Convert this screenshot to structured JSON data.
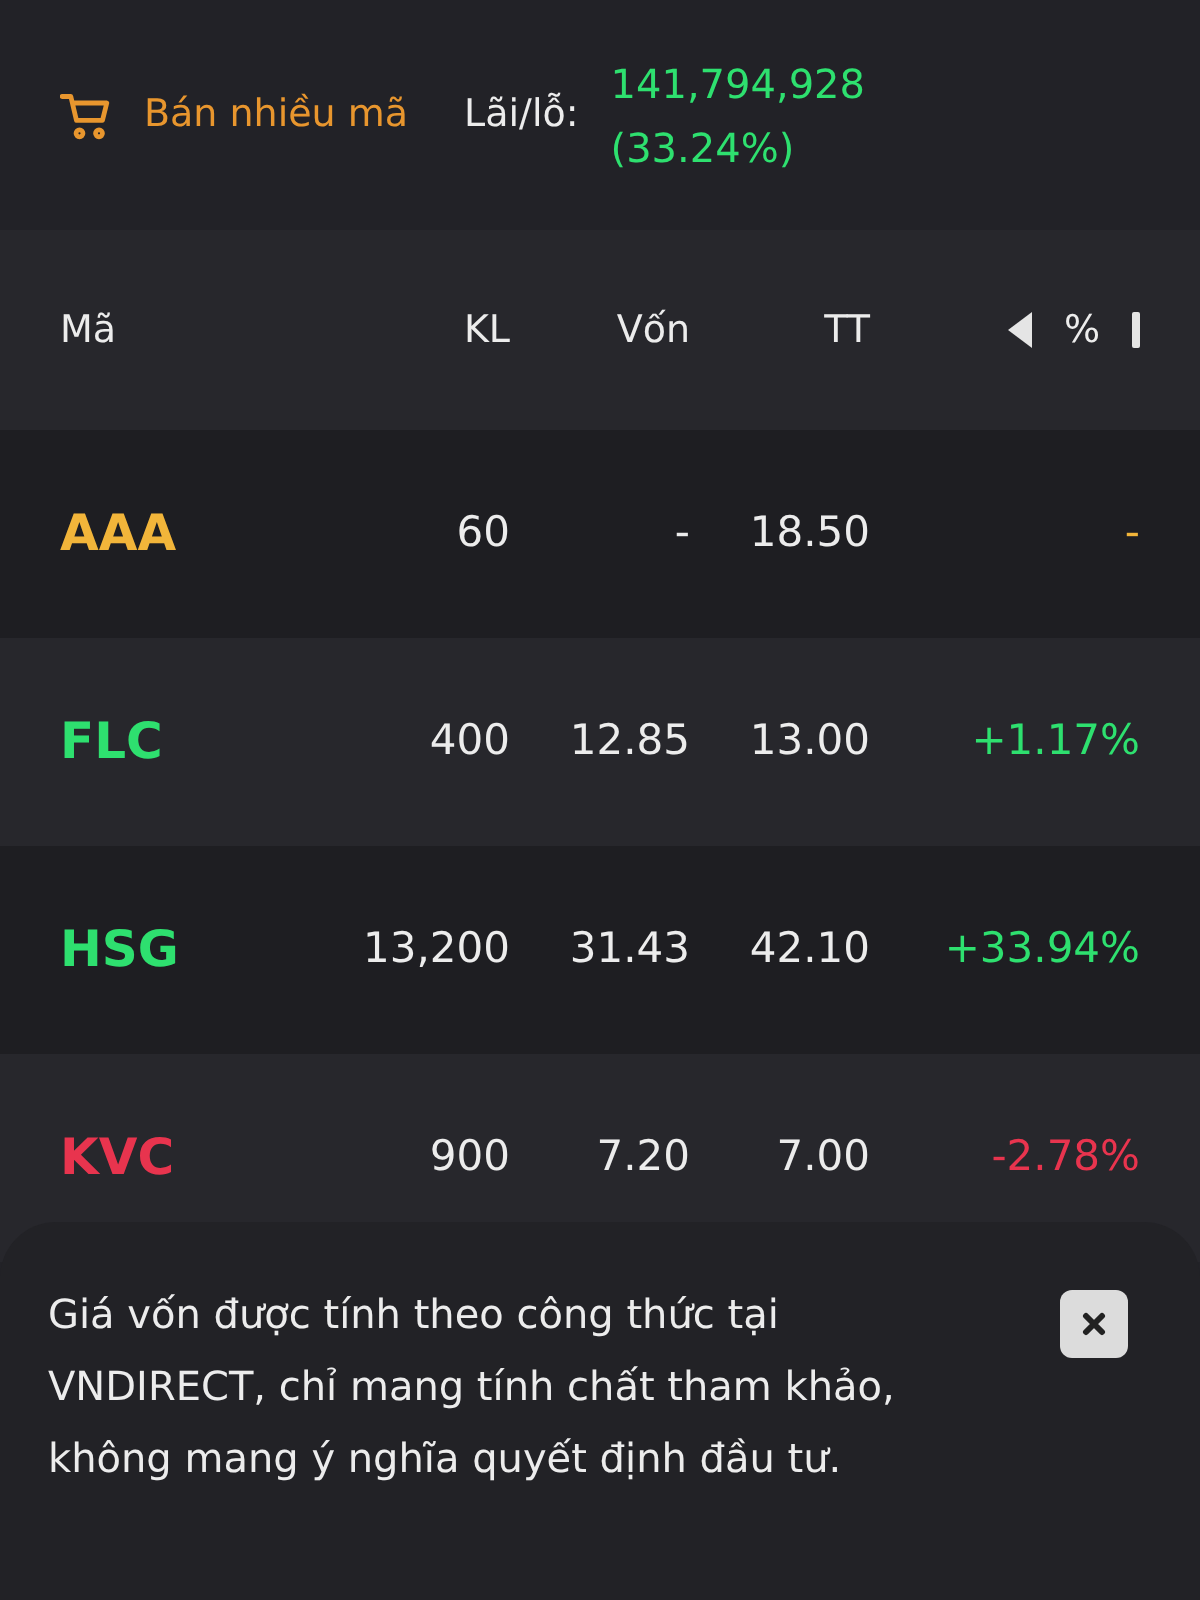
{
  "header": {
    "sell_button": "Bán nhiều mã",
    "pnl_label": "Lãi/lỗ:",
    "pnl_value": "141,794,928",
    "pnl_percent": "(33.24%)"
  },
  "table": {
    "columns": [
      "Mã",
      "KL",
      "Vốn",
      "TT",
      "%"
    ],
    "rows": [
      {
        "symbol": "AAA",
        "volume": "60",
        "cost": "-",
        "price": "18.50",
        "change": "-",
        "kind": "ref"
      },
      {
        "symbol": "FLC",
        "volume": "400",
        "cost": "12.85",
        "price": "13.00",
        "change": "+1.17%",
        "kind": "up"
      },
      {
        "symbol": "HSG",
        "volume": "13,200",
        "cost": "31.43",
        "price": "42.10",
        "change": "+33.94%",
        "kind": "up"
      },
      {
        "symbol": "KVC",
        "volume": "900",
        "cost": "7.20",
        "price": "7.00",
        "change": "-2.78%",
        "kind": "down"
      }
    ]
  },
  "notice": {
    "text": "Giá vốn được tính theo công thức tại VNDIRECT, chỉ mang tính chất tham khảo, không mang ý nghĩa quyết định đầu tư."
  }
}
